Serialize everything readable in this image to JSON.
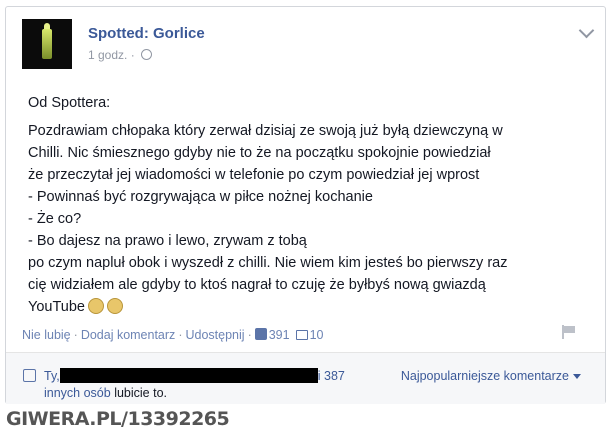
{
  "post": {
    "page_name": "Spotted: Gorlice",
    "time": "1 godz.",
    "intro": "Od Spottera:",
    "lines": [
      "Pozdrawiam chłopaka który zerwał dzisiaj ze swoją już byłą dziewczyną w",
      "Chilli. Nic śmiesznego gdyby nie to że na początku spokojnie powiedział",
      "że przeczytał jej wiadomości w telefonie po czym powiedział jej wprost",
      "- Powinnaś być rozgrywająca w piłce nożnej kochanie",
      "- Że co?",
      "- Bo dajesz na prawo i lewo, zrywam z tobą",
      "po czym napluł obok i wyszedł z chilli. Nie wiem kim jesteś bo pierwszy raz",
      "cię widziałem ale gdyby to ktoś nagrał to czuję że byłbyś nową gwiazdą",
      "YouTube"
    ]
  },
  "actions": {
    "unlike": "Nie lubię",
    "comment": "Dodaj komentarz",
    "share": "Udostępnij",
    "like_count": "391",
    "comment_count": "10"
  },
  "likes": {
    "prefix": "Ty,",
    "suffix": "i 387",
    "others_link": "innych osób",
    "others_text": " lubicie to.",
    "sort_label": "Najpopularniejsze komentarze"
  },
  "watermark": "GIWERA.PL/13392265",
  "colors": {
    "link": "#3b5998",
    "muted": "#9197a3",
    "text": "#141823"
  }
}
